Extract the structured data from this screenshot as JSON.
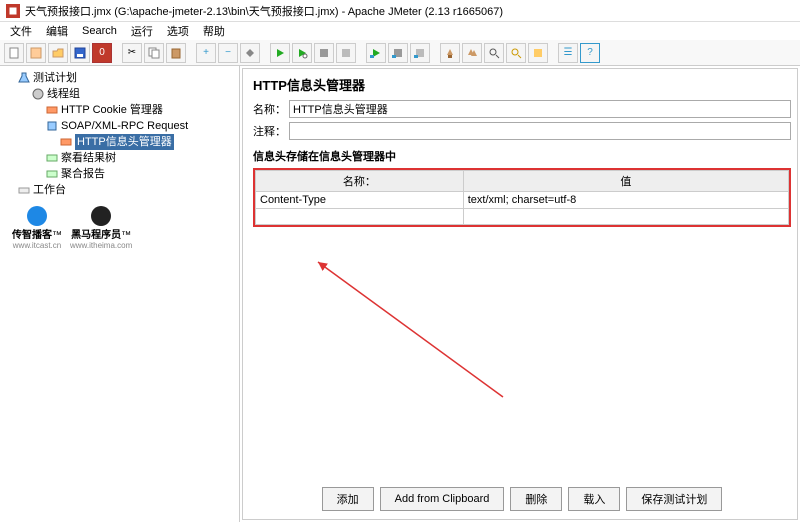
{
  "window": {
    "title": "天气预报接口.jmx (G:\\apache-jmeter-2.13\\bin\\天气预报接口.jmx) - Apache JMeter (2.13 r1665067)"
  },
  "menu": {
    "file": "文件",
    "edit": "编辑",
    "search": "Search",
    "run": "运行",
    "options": "选项",
    "help": "帮助"
  },
  "toolbar": {
    "count": "0"
  },
  "tree": {
    "root": "测试计划",
    "tg": "线程组",
    "cookie": "HTTP Cookie 管理器",
    "soap": "SOAP/XML-RPC Request",
    "header": "HTTP信息头管理器",
    "view": "察看结果树",
    "agg": "聚合报告",
    "workbench": "工作台"
  },
  "logos": {
    "a_name": "传智播客",
    "a_tm": "™",
    "a_url": "www.itcast.cn",
    "b_name": "黑马程序员",
    "b_tm": "™",
    "b_url": "www.itheima.com"
  },
  "panel": {
    "title": "HTTP信息头管理器",
    "name_label": "名称：",
    "name_value": "HTTP信息头管理器",
    "comment_label": "注释：",
    "comment_value": "",
    "store_label": "信息头存储在信息头管理器中",
    "col_name": "名称：",
    "col_value": "值",
    "rows": [
      {
        "name": "Content-Type",
        "value": "text/xml; charset=utf-8"
      }
    ]
  },
  "buttons": {
    "add": "添加",
    "clip": "Add from Clipboard",
    "del": "删除",
    "load": "载入",
    "save": "保存测试计划"
  }
}
